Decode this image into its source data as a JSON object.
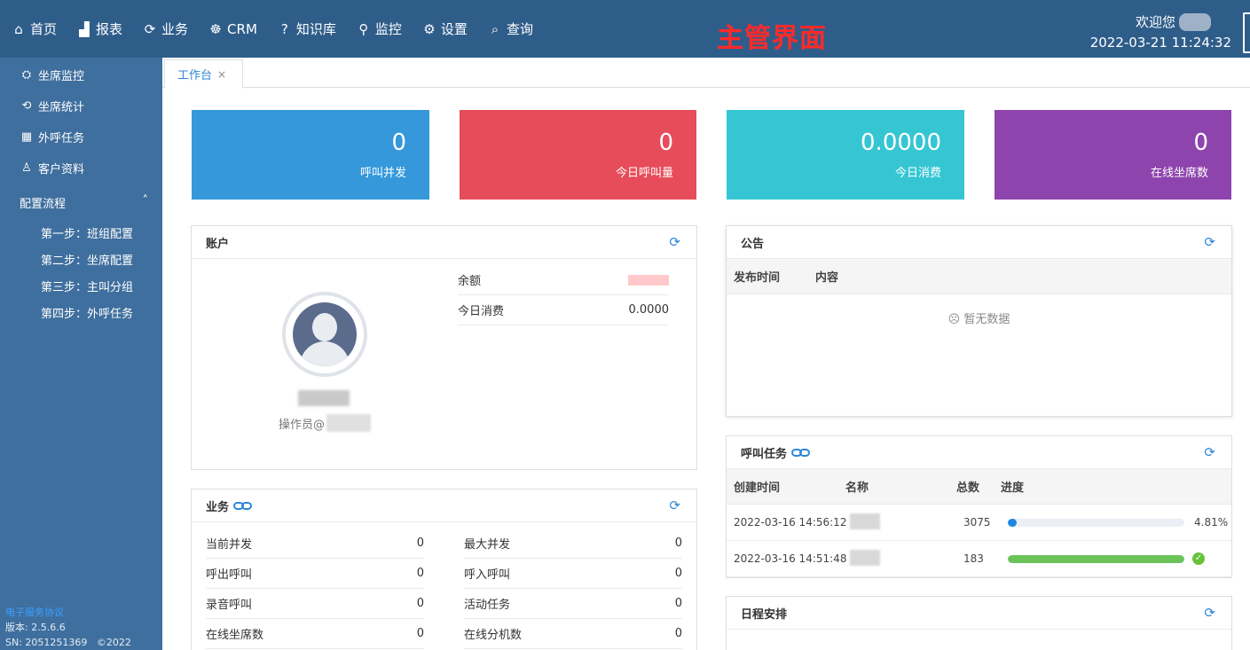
{
  "topbar": {
    "nav": [
      {
        "label": "首页",
        "icon": "home-icon"
      },
      {
        "label": "报表",
        "icon": "bar-chart-icon"
      },
      {
        "label": "业务",
        "icon": "cycle-icon"
      },
      {
        "label": "CRM",
        "icon": "handshake-icon"
      },
      {
        "label": "知识库",
        "icon": "question-icon"
      },
      {
        "label": "监控",
        "icon": "monitor-icon"
      },
      {
        "label": "设置",
        "icon": "gear-icon"
      },
      {
        "label": "查询",
        "icon": "search-icon"
      }
    ],
    "banner": "主管界面",
    "welcome": "欢迎您",
    "datetime": "2022-03-21 11:24:32"
  },
  "sidebar": {
    "items": [
      {
        "label": "坐席监控",
        "icon": "agent-monitor-icon"
      },
      {
        "label": "坐席统计",
        "icon": "agent-stats-icon"
      },
      {
        "label": "外呼任务",
        "icon": "grid-icon"
      },
      {
        "label": "客户资料",
        "icon": "user-icon"
      }
    ],
    "group": {
      "label": "配置流程",
      "expanded": true
    },
    "sub_items": [
      "第一步：班组配置",
      "第二步：坐席配置",
      "第三步：主叫分组",
      "第四步：外呼任务"
    ],
    "footer": {
      "agreement": "电子服务协议",
      "version": "版本: 2.5.6.6",
      "sn": "SN: 2051251369",
      "copyright": "©2022"
    }
  },
  "tabs": [
    {
      "label": "工作台",
      "close": "×"
    }
  ],
  "stats": [
    {
      "value": "0",
      "label": "呼叫并发",
      "color": "#3498db"
    },
    {
      "value": "0",
      "label": "今日呼叫量",
      "color": "#e74c5a"
    },
    {
      "value": "0.0000",
      "label": "今日消费",
      "color": "#36c6d3"
    },
    {
      "value": "0",
      "label": "在线坐席数",
      "color": "#8e44ad"
    }
  ],
  "account": {
    "title": "账户",
    "operator_prefix": "操作员@",
    "rows": [
      {
        "label": "余额",
        "value": ""
      },
      {
        "label": "今日消费",
        "value": "0.0000"
      }
    ]
  },
  "business": {
    "title": "业务",
    "left": [
      {
        "label": "当前并发",
        "value": "0"
      },
      {
        "label": "呼出呼叫",
        "value": "0"
      },
      {
        "label": "录音呼叫",
        "value": "0"
      },
      {
        "label": "在线坐席数",
        "value": "0"
      }
    ],
    "right": [
      {
        "label": "最大并发",
        "value": "0"
      },
      {
        "label": "呼入呼叫",
        "value": "0"
      },
      {
        "label": "活动任务",
        "value": "0"
      },
      {
        "label": "在线分机数",
        "value": "0"
      }
    ]
  },
  "notice": {
    "title": "公告",
    "columns": [
      "发布时间",
      "内容"
    ],
    "empty": "暂无数据"
  },
  "tasks": {
    "title": "呼叫任务",
    "columns": [
      "创建时间",
      "名称",
      "总数",
      "进度"
    ],
    "rows": [
      {
        "created": "2022-03-16 14:56:12",
        "total": "3075",
        "progress": 0.0481,
        "progress_text": "4.81%",
        "bar_color": "#1e88e5"
      },
      {
        "created": "2022-03-16 14:51:48",
        "total": "183",
        "progress": 1.0,
        "progress_text": "",
        "bar_color": "#6cc35a"
      }
    ]
  },
  "schedule": {
    "title": "日程安排"
  }
}
